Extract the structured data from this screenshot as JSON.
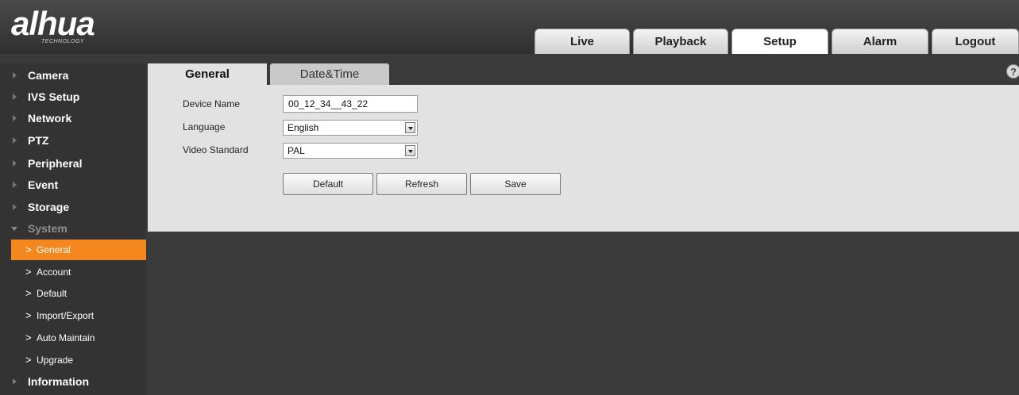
{
  "header": {
    "logo": "alhua",
    "logo_sub": "TECHNOLOGY",
    "tabs": [
      "Live",
      "Playback",
      "Setup",
      "Alarm",
      "Logout"
    ],
    "active_tab": "Setup"
  },
  "sidebar": {
    "items": [
      {
        "label": "Camera"
      },
      {
        "label": "IVS Setup"
      },
      {
        "label": "Network"
      },
      {
        "label": "PTZ"
      },
      {
        "label": "Peripheral"
      },
      {
        "label": "Event"
      },
      {
        "label": "Storage"
      },
      {
        "label": "System"
      }
    ],
    "sub_items": [
      {
        "label": "General"
      },
      {
        "label": "Account"
      },
      {
        "label": "Default"
      },
      {
        "label": "Import/Export"
      },
      {
        "label": "Auto Maintain"
      },
      {
        "label": "Upgrade"
      }
    ],
    "last_item": {
      "label": "Information"
    },
    "active_sub": "General",
    "accent_color": "#f5871f"
  },
  "content": {
    "tabs": [
      "General",
      "Date&Time"
    ],
    "active_tab": "General",
    "help_icon": "?",
    "fields": {
      "device_name_label": "Device Name",
      "device_name_value": "00_12_34__43_22",
      "language_label": "Language",
      "language_value": "English",
      "video_standard_label": "Video Standard",
      "video_standard_value": "PAL"
    },
    "buttons": {
      "default": "Default",
      "refresh": "Refresh",
      "save": "Save"
    }
  }
}
